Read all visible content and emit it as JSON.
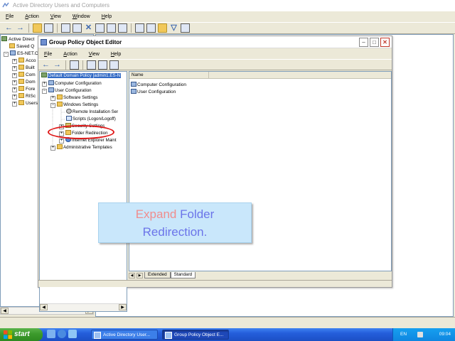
{
  "ad_window": {
    "title": "Active Directory Users and Computers",
    "menu": [
      "File",
      "Action",
      "View",
      "Window",
      "Help"
    ],
    "tree": [
      {
        "label": "Active Direct",
        "icon": "book-icon",
        "level": 0,
        "expander": ""
      },
      {
        "label": "Saved Q",
        "icon": "folder-icon",
        "level": 1,
        "expander": ""
      },
      {
        "label": "ES-NET.C",
        "icon": "domain-icon",
        "level": 1,
        "expander": "-"
      },
      {
        "label": "Acco",
        "icon": "folder-icon",
        "level": 2,
        "expander": "+"
      },
      {
        "label": "Built",
        "icon": "folder-icon",
        "level": 2,
        "expander": "+"
      },
      {
        "label": "Com",
        "icon": "folder-icon",
        "level": 2,
        "expander": "+"
      },
      {
        "label": "Dom",
        "icon": "folder-icon",
        "level": 2,
        "expander": "+"
      },
      {
        "label": "Fore",
        "icon": "folder-icon",
        "level": 2,
        "expander": "+"
      },
      {
        "label": "RISc",
        "icon": "folder-icon",
        "level": 2,
        "expander": "+"
      },
      {
        "label": "Users",
        "icon": "folder-icon",
        "level": 2,
        "expander": "+"
      }
    ]
  },
  "gpo_window": {
    "title": "Group Policy Object Editor",
    "menu": [
      "File",
      "Action",
      "View",
      "Help"
    ],
    "tree": {
      "root": "Default Domain Policy [admin1.ES-N",
      "computer_configuration": "Computer Configuration",
      "user_configuration": "User Configuration",
      "software_settings": "Software Settings",
      "windows_settings": "Windows Settings",
      "remote_installation": "Remote Installation Ser",
      "scripts": "Scripts (Logon/Logoff)",
      "security_settings": "Security Settings",
      "folder_redirection": "Folder Redirection",
      "ie_maintenance": "Internet Explorer Maint",
      "administrative_templates": "Administrative Templates"
    },
    "list_column_name": "Name",
    "list_items": [
      "Computer Configuration",
      "User Configuration"
    ],
    "tabs": [
      "Extended",
      "Standard"
    ],
    "active_tab": "Standard"
  },
  "callout": {
    "word1": "Expand",
    "word2": "Folder",
    "word3": "Redirection."
  },
  "taskbar": {
    "start_label": "start",
    "tasks": [
      "Active Directory User...",
      "Group Policy Object E..."
    ],
    "language": "EN",
    "clock": "09:04"
  },
  "colors": {
    "highlight_ellipse": "#e01818",
    "callout_bg": "#c9e7fb",
    "callout_red": "#f08d8d",
    "callout_blue": "#6b74e9",
    "taskbar_blue": "#245edb",
    "start_green": "#3c9a2c"
  }
}
